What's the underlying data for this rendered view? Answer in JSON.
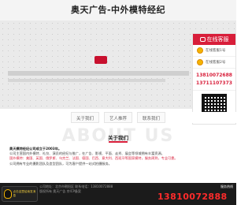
{
  "header": {
    "title": "奥天广告-中外模特经纪"
  },
  "sidebar": {
    "title": "在线客服",
    "items": [
      {
        "label": "在线客服1号"
      },
      {
        "label": "在线客服2号"
      }
    ],
    "phones": [
      "13810072688",
      "13711107373"
    ]
  },
  "nav": {
    "items": [
      {
        "label": "关于我们"
      },
      {
        "label": "艺人推荐"
      },
      {
        "label": "联系我们"
      }
    ]
  },
  "about": {
    "bg_text": "ABOUT US",
    "title": "关于我们"
  },
  "content": {
    "lead": "奥天模特经纪公司成立于2003年。",
    "p1": "公司主营国内外模特、礼仪、演员的经纪与推广，在广告、影视、平面、走秀、展会等领域拥有丰富资源。",
    "p2": "国外模特：美国、英国、俄罗斯、乌克兰、法国、德国、巴西、意大利、西班牙等国家模特，服务周到，专业可靠。",
    "p3": "公司拥有专业的摄影团队及造型团队，可为客户提供一站式拍摄服务。"
  },
  "footer": {
    "line1": "公司地址：北京市朝阳区  联系电话：13810072888",
    "line2": "版权所有 奥天广告 京ICP备案",
    "hotline": "13810072888",
    "service_label": "服务热线"
  },
  "float_widget": {
    "text": "点击这里给我发消息"
  }
}
